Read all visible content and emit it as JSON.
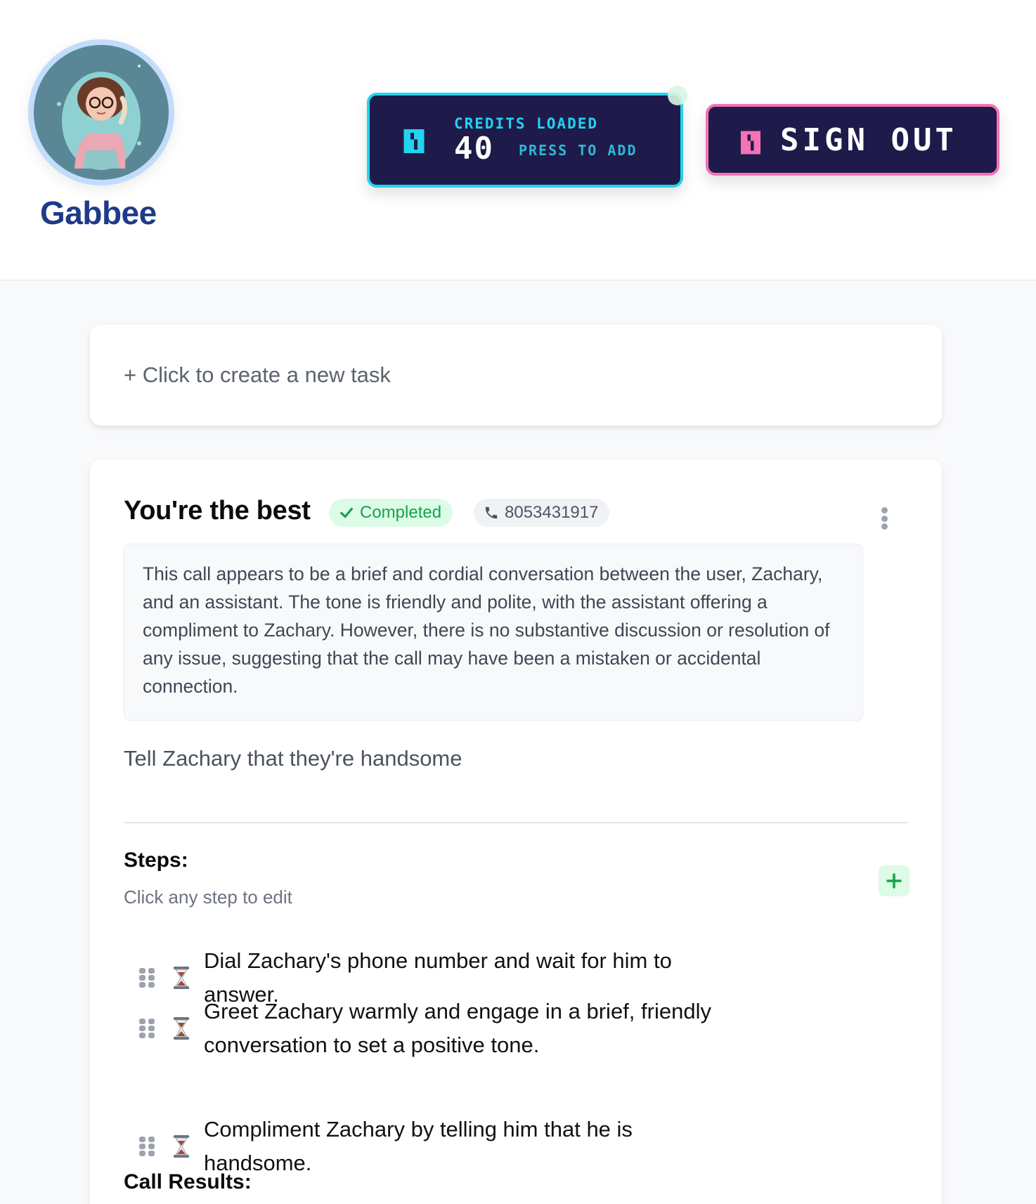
{
  "header": {
    "brand_name": "Gabbee",
    "avatar_alt": "Gabbee assistant avatar",
    "credits": {
      "label": "CREDITS LOADED",
      "count": "40",
      "action": "PRESS TO ADD",
      "accent_color": "#22d3ee"
    },
    "sign_out": {
      "label": "SIGN OUT",
      "accent_color": "#f472b6"
    }
  },
  "new_task": {
    "label": "+ Click to create a new task"
  },
  "task": {
    "title": "You're the best",
    "status": "Completed",
    "status_color": "#16a34a",
    "phone": "8053431917",
    "summary": "This call appears to be a brief and cordial conversation between the user, Zachary, and an assistant. The tone is friendly and polite, with the assistant offering a compliment to Zachary. However, there is no substantive discussion or resolution of any issue, suggesting that the call may have been a mistaken or accidental connection.",
    "instruction": "Tell Zachary that they're handsome",
    "steps_title": "Steps:",
    "steps_hint": "Click any step to edit",
    "steps": [
      {
        "text": "Dial Zachary's phone number and wait for him to answer.",
        "status_icon": "hourglass-icon"
      },
      {
        "text": "Greet Zachary warmly and engage in a brief, friendly conversation to set a positive tone.",
        "status_icon": "hourglass-icon"
      },
      {
        "text": "Compliment Zachary by telling him that he is handsome.",
        "status_icon": "hourglass-icon"
      }
    ],
    "results_title": "Call Results:"
  }
}
